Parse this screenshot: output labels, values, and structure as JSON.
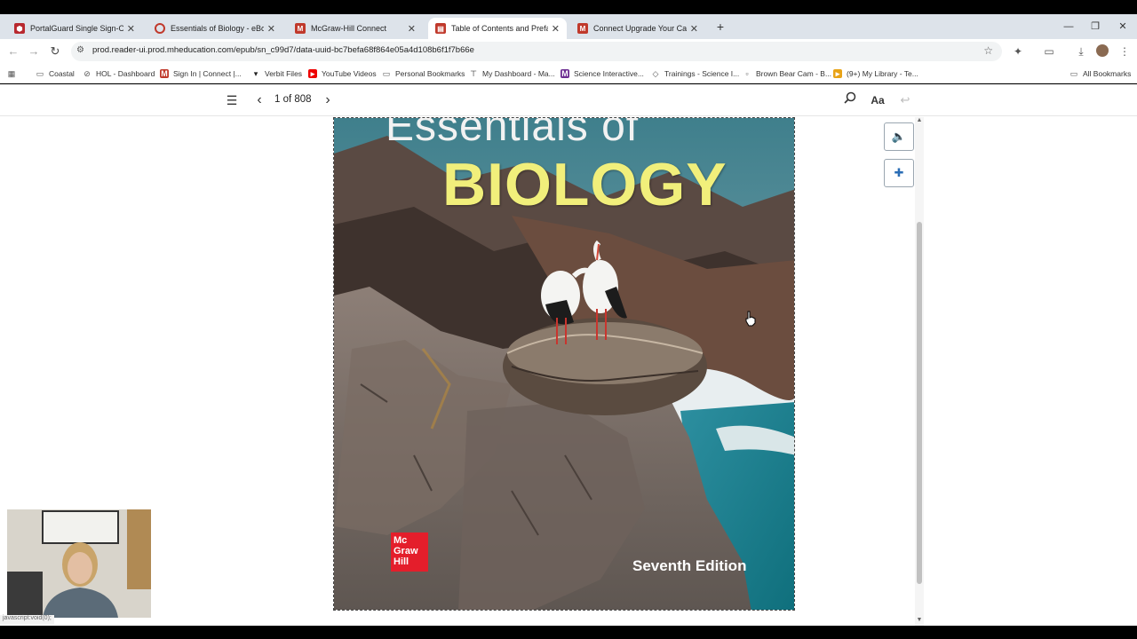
{
  "browser": {
    "tabs": [
      {
        "title": "PortalGuard Single Sign-On",
        "icon": "portalguard-icon",
        "color": "#c0392b",
        "active": false
      },
      {
        "title": "Essentials of Biology - eBook",
        "icon": "ebook-icon",
        "color": "#c0392b",
        "active": false
      },
      {
        "title": "McGraw-Hill Connect",
        "icon": "mcgraw-hill-icon",
        "color": "#c0392b",
        "active": false
      },
      {
        "title": "Table of Contents and Preface",
        "icon": "reader-icon",
        "color": "#c0392b",
        "active": true
      },
      {
        "title": "Connect Upgrade Your Canvas",
        "icon": "mcgraw-hill-icon",
        "color": "#c0392b",
        "active": false
      }
    ],
    "new_tab": "+",
    "window_controls": {
      "minimize": "—",
      "restore": "❐",
      "close": "✕"
    },
    "url": "prod.reader-ui.prod.mheducation.com/epub/sn_c99d7/data-uuid-bc7befa68f864e05a4d108b6f1f7b66e",
    "bookmarks": [
      {
        "label": "Coastal",
        "icon": "folder-icon"
      },
      {
        "label": "HOL - Dashboard",
        "icon": "hol-icon"
      },
      {
        "label": "Sign In | Connect |...",
        "icon": "mcgraw-hill-icon"
      },
      {
        "label": "Verbit Files",
        "icon": "verbit-icon"
      },
      {
        "label": "YouTube Videos",
        "icon": "youtube-icon"
      },
      {
        "label": "Personal Bookmarks",
        "icon": "folder-icon"
      },
      {
        "label": "My Dashboard - Ma...",
        "icon": "dashboard-icon"
      },
      {
        "label": "Science Interactive...",
        "icon": "science-icon"
      },
      {
        "label": "Trainings - Science I...",
        "icon": "trainings-icon"
      },
      {
        "label": "Brown Bear Cam - B...",
        "icon": "page-icon"
      },
      {
        "label": "(9+) My Library - Te...",
        "icon": "library-icon"
      }
    ],
    "all_bookmarks": "All Bookmarks",
    "status_text": "javascript:void(0);"
  },
  "reader": {
    "page_indicator": "1 of 808",
    "font_button": "Aa"
  },
  "cover": {
    "title_line1": "Essentials of",
    "title_line2": "BIOLOGY",
    "edition": "Seventh Edition",
    "publisher_logo_line1": "Mc",
    "publisher_logo_line2": "Graw",
    "publisher_logo_line3": "Hill"
  },
  "colors": {
    "accent_red": "#e41e2b",
    "title_yellow": "#f1ef7b"
  }
}
